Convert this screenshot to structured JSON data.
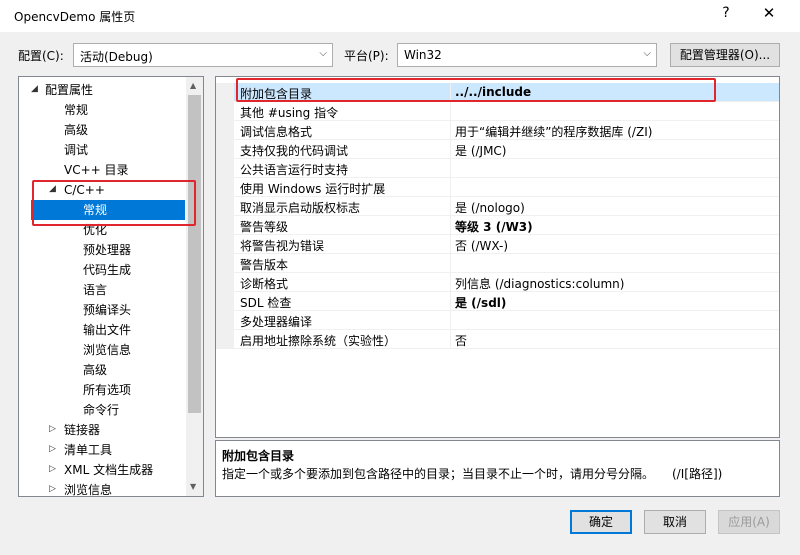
{
  "window": {
    "title": "OpencvDemo 属性页",
    "help": "?",
    "close": "✕"
  },
  "toolbar": {
    "config_label": "配置(C):",
    "config_value": "活动(Debug)",
    "platform_label": "平台(P):",
    "platform_value": "Win32",
    "config_manager": "配置管理器(O)..."
  },
  "tree": {
    "root": "配置属性",
    "items": [
      "常规",
      "高级",
      "调试",
      "VC++ 目录"
    ],
    "cpp": "C/C++",
    "cpp_children": [
      "常规",
      "优化",
      "预处理器",
      "代码生成",
      "语言",
      "预编译头",
      "输出文件",
      "浏览信息",
      "高级",
      "所有选项",
      "命令行"
    ],
    "collapsed": [
      "链接器",
      "清单工具",
      "XML 文档生成器",
      "浏览信息"
    ]
  },
  "grid": {
    "rows": [
      {
        "name": "附加包含目录",
        "value": "../../include",
        "bold": true
      },
      {
        "name": "其他 #using 指令",
        "value": ""
      },
      {
        "name": "调试信息格式",
        "value": "用于“编辑并继续”的程序数据库 (/ZI)"
      },
      {
        "name": "支持仅我的代码调试",
        "value": "是 (/JMC)"
      },
      {
        "name": "公共语言运行时支持",
        "value": ""
      },
      {
        "name": "使用 Windows 运行时扩展",
        "value": ""
      },
      {
        "name": "取消显示启动版权标志",
        "value": "是 (/nologo)"
      },
      {
        "name": "警告等级",
        "value": "等级 3 (/W3)",
        "bold": true
      },
      {
        "name": "将警告视为错误",
        "value": "否 (/WX-)"
      },
      {
        "name": "警告版本",
        "value": ""
      },
      {
        "name": "诊断格式",
        "value": "列信息 (/diagnostics:column)"
      },
      {
        "name": "SDL 检查",
        "value": "是 (/sdl)",
        "bold": true
      },
      {
        "name": "多处理器编译",
        "value": ""
      },
      {
        "name": "启用地址擦除系统（实验性）",
        "value": "否"
      }
    ]
  },
  "description": {
    "title": "附加包含目录",
    "text": "指定一个或多个要添加到包含路径中的目录；当目录不止一个时，请用分号分隔。",
    "switch": "(/I[路径])"
  },
  "footer": {
    "ok": "确定",
    "cancel": "取消",
    "apply": "应用(A)"
  },
  "colors": {
    "selection": "#0078d7",
    "highlight": "#e0262c",
    "active_row": "#cce8ff"
  }
}
